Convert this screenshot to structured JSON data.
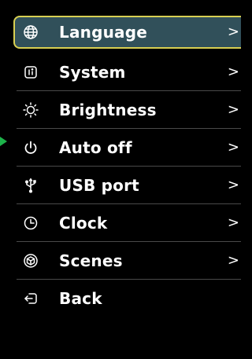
{
  "menu": {
    "items": [
      {
        "label": "Language",
        "icon": "globe-icon",
        "chevron": ">",
        "selected": true
      },
      {
        "label": "System",
        "icon": "info-icon",
        "chevron": ">"
      },
      {
        "label": "Brightness",
        "icon": "sun-icon",
        "chevron": ">"
      },
      {
        "label": "Auto off",
        "icon": "power-icon",
        "chevron": ">"
      },
      {
        "label": "USB port",
        "icon": "usb-icon",
        "chevron": ">"
      },
      {
        "label": "Clock",
        "icon": "clock-icon",
        "chevron": ">"
      },
      {
        "label": "Scenes",
        "icon": "cube-icon",
        "chevron": ">"
      },
      {
        "label": "Back",
        "icon": "exit-icon"
      }
    ]
  },
  "colors": {
    "background": "#000000",
    "selected_fill": "#31505a",
    "selected_border": "#d8cf52",
    "pointer_arrow": "#1db34a",
    "divider": "#4a4a4a"
  }
}
